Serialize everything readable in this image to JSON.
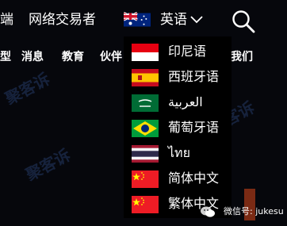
{
  "header": {
    "nav_cut": "端",
    "network_traders": "网络交易者",
    "language_current": "英语",
    "language_flag_icon": "australia-flag-icon",
    "search_icon": "search-icon"
  },
  "subnav": {
    "cut_left": "型",
    "news": "消息",
    "education": "教育",
    "partners_cut": "伙伴",
    "about_us": "我们"
  },
  "language_menu": [
    {
      "label": "印尼语",
      "icon": "indonesia-flag-icon"
    },
    {
      "label": "西班牙语",
      "icon": "spain-flag-icon"
    },
    {
      "label": "العربية",
      "icon": "saudi-arabia-flag-icon"
    },
    {
      "label": "葡萄牙语",
      "icon": "brazil-flag-icon"
    },
    {
      "label": "ไทย",
      "icon": "thailand-flag-icon"
    },
    {
      "label": "简体中文",
      "icon": "china-flag-icon"
    },
    {
      "label": "繁体中文",
      "icon": "china-flag-icon"
    }
  ],
  "watermark": {
    "text": "聚客诉"
  },
  "wechat": {
    "label": "微信号: jukesu",
    "icon": "wechat-icon"
  },
  "colors": {
    "background": "#06070c",
    "dropdown": "#000000",
    "text": "#ffffff"
  }
}
